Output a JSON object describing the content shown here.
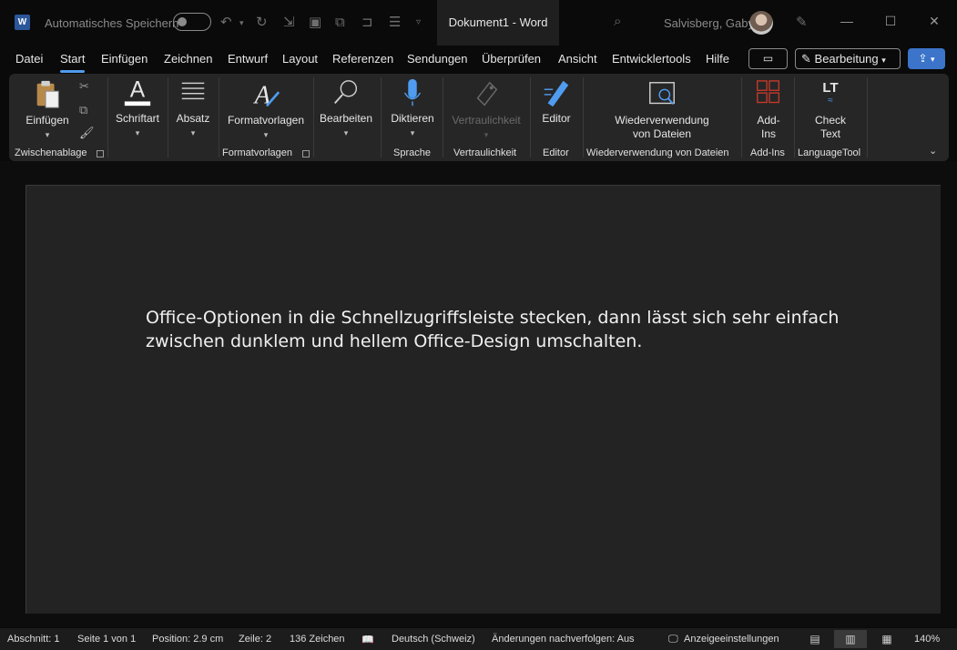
{
  "titlebar": {
    "app_icon_letter": "W",
    "autosave_label": "Automatisches Speichern",
    "document_title": "Dokument1  -  Word",
    "user_name": "Salvisberg, Gaby"
  },
  "menu": {
    "items": [
      "Datei",
      "Start",
      "Einfügen",
      "Zeichnen",
      "Entwurf",
      "Layout",
      "Referenzen",
      "Sendungen",
      "Überprüfen",
      "Ansicht",
      "Entwicklertools",
      "Hilfe"
    ],
    "active": "Start",
    "edit_mode_label": "Bearbeitung"
  },
  "ribbon": {
    "paste": "Einfügen",
    "group_clipboard": "Zwischenablage",
    "font": "Schriftart",
    "paragraph": "Absatz",
    "styles": "Formatvorlagen",
    "group_styles": "Formatvorlagen",
    "editing": "Bearbeiten",
    "dictate": "Diktieren",
    "group_voice": "Sprache",
    "sensitivity": "Vertraulichkeit",
    "group_sensitivity": "Vertraulichkeit",
    "editor": "Editor",
    "group_editor": "Editor",
    "reuse_line1": "Wiederverwendung",
    "reuse_line2": "von Dateien",
    "group_reuse": "Wiederverwendung von Dateien",
    "addins_line1": "Add-",
    "addins_line2": "Ins",
    "group_addins": "Add-Ins",
    "check_line1": "Check",
    "check_line2": "Text",
    "group_languagetool": "LanguageTool",
    "lt_logo": "LT"
  },
  "document": {
    "line1": "Office-Optionen in die Schnellzugriffsleiste stecken, dann lässt sich sehr einfach",
    "line2": "zwischen dunklem und hellem Office-Design umschalten."
  },
  "statusbar": {
    "section": "Abschnitt: 1",
    "page": "Seite 1 von 1",
    "position": "Position: 2.9 cm",
    "line": "Zeile: 2",
    "chars": "136 Zeichen",
    "language": "Deutsch (Schweiz)",
    "track_changes": "Änderungen nachverfolgen: Aus",
    "display_settings": "Anzeigeeinstellungen",
    "zoom": "140%"
  },
  "colors": {
    "accent": "#4f9cf0",
    "share": "#3b74c8",
    "word_brand": "#2b579a",
    "addins_icon": "#c0392b"
  }
}
